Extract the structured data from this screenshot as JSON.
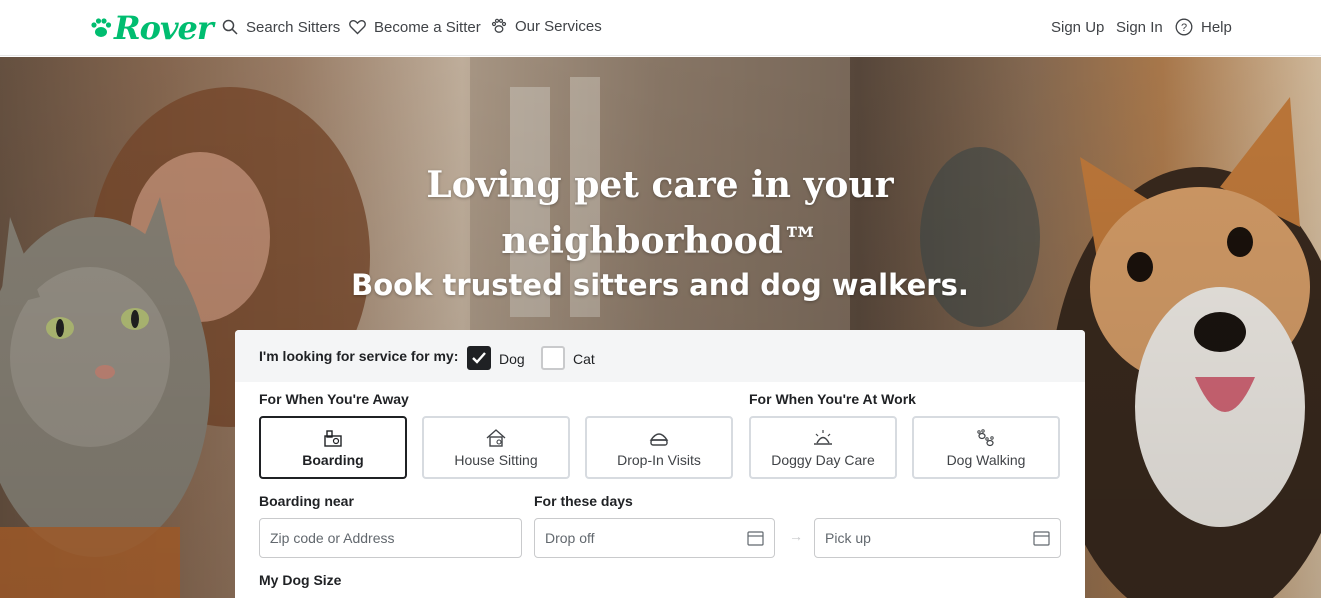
{
  "brand": {
    "name": "Rover",
    "color": "#00bd70"
  },
  "nav": {
    "search_sitters": "Search Sitters",
    "become_sitter": "Become a Sitter",
    "our_services": "Our Services",
    "sign_up": "Sign Up",
    "sign_in": "Sign In",
    "help": "Help"
  },
  "hero": {
    "title_line1": "Loving pet care in your",
    "title_line2": "neighborhood™",
    "subtitle": "Book trusted sitters and dog walkers."
  },
  "form": {
    "looking_for_label": "I'm looking for service for my:",
    "pets": [
      {
        "label": "Dog",
        "checked": true
      },
      {
        "label": "Cat",
        "checked": false
      }
    ],
    "away_heading": "For When You're Away",
    "work_heading": "For When You're At Work",
    "services": [
      {
        "label": "Boarding",
        "icon": "boarding-icon",
        "selected": true
      },
      {
        "label": "House Sitting",
        "icon": "house-icon",
        "selected": false
      },
      {
        "label": "Drop-In Visits",
        "icon": "bowl-icon",
        "selected": false
      },
      {
        "label": "Doggy Day Care",
        "icon": "sun-icon",
        "selected": false
      },
      {
        "label": "Dog Walking",
        "icon": "paws-icon",
        "selected": false
      }
    ],
    "boarding_near_label": "Boarding near",
    "location_placeholder": "Zip code or Address",
    "days_label": "For these days",
    "drop_off_placeholder": "Drop off",
    "pick_up_placeholder": "Pick up",
    "dog_size_label": "My Dog Size"
  }
}
